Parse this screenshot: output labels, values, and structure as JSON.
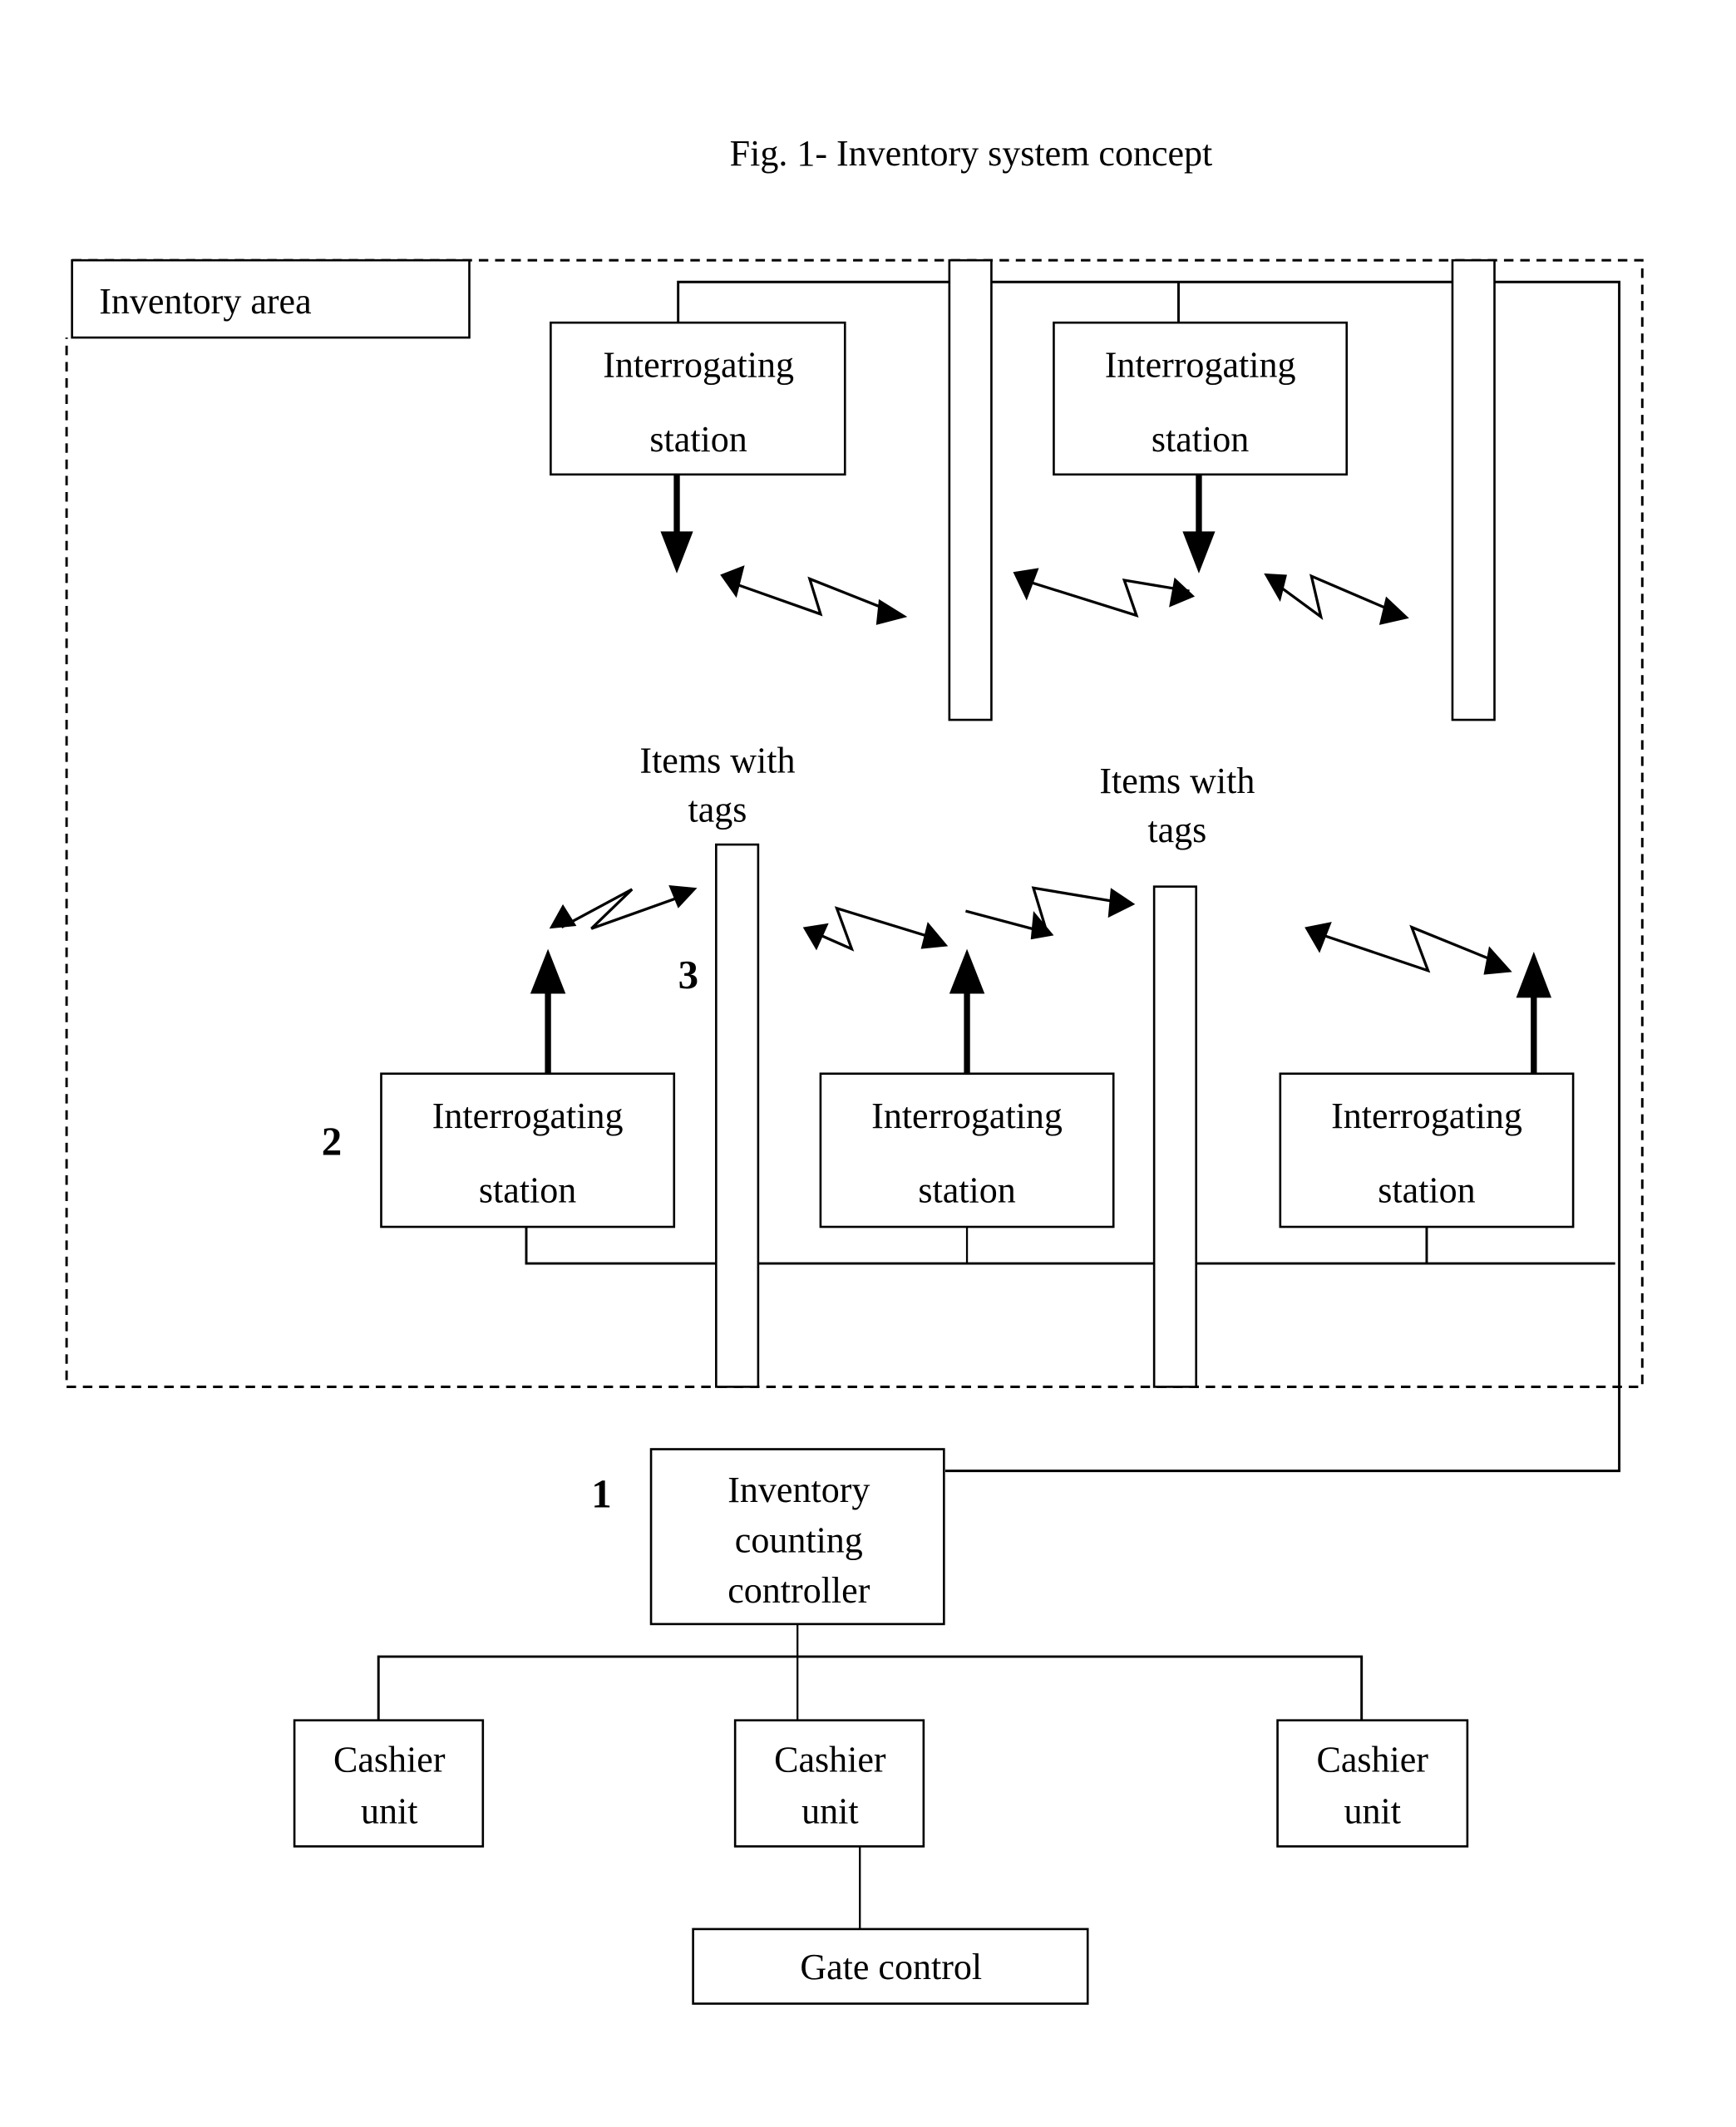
{
  "figure": {
    "title": "Fig. 1- Inventory system concept",
    "area_label": "Inventory area",
    "top_stations": [
      {
        "line1": "Interrogating",
        "line2": "station"
      },
      {
        "line1": "Interrogating",
        "line2": "station"
      }
    ],
    "bottom_stations": [
      {
        "line1": "Interrogating",
        "line2": "station"
      },
      {
        "line1": "Interrogating",
        "line2": "station"
      },
      {
        "line1": "Interrogating",
        "line2": "station"
      }
    ],
    "shelf_labels": [
      {
        "line1": "Items with",
        "line2": "tags"
      },
      {
        "line1": "Items with",
        "line2": "tags"
      }
    ],
    "reference_numerals": {
      "controller": "1",
      "station": "2",
      "shelf": "3"
    },
    "controller": {
      "line1": "Inventory",
      "line2": "counting",
      "line3": "controller"
    },
    "cashier_units": [
      {
        "line1": "Cashier",
        "line2": "unit"
      },
      {
        "line1": "Cashier",
        "line2": "unit"
      },
      {
        "line1": "Cashier",
        "line2": "unit"
      }
    ],
    "gate_control": "Gate control"
  }
}
